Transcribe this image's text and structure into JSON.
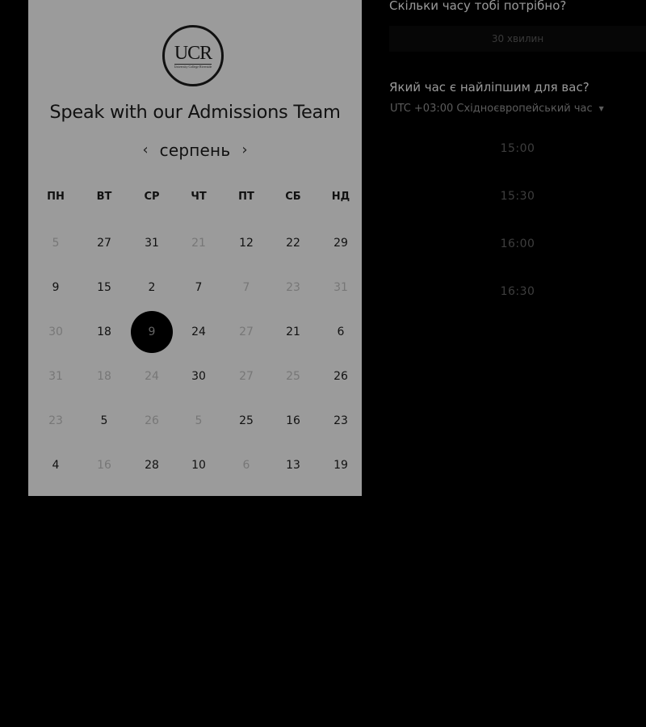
{
  "logo": {
    "text": "UCR",
    "subtext": "University College Riverside"
  },
  "title": "Speak with our Admissions Team",
  "calendar": {
    "month": "серпень",
    "prev_icon": "chevron-left-icon",
    "next_icon": "chevron-right-icon",
    "weekdays": [
      "ПН",
      "ВТ",
      "СР",
      "ЧТ",
      "ПТ",
      "СБ",
      "НД"
    ],
    "weeks": [
      [
        {
          "d": "5",
          "muted": true
        },
        {
          "d": "27",
          "muted": false
        },
        {
          "d": "31",
          "muted": false
        },
        {
          "d": "21",
          "muted": true
        },
        {
          "d": "12",
          "muted": false
        },
        {
          "d": "22",
          "muted": false
        },
        {
          "d": "29",
          "muted": false
        }
      ],
      [
        {
          "d": "9",
          "muted": false
        },
        {
          "d": "15",
          "muted": false
        },
        {
          "d": "2",
          "muted": false
        },
        {
          "d": "7",
          "muted": false
        },
        {
          "d": "7",
          "muted": true
        },
        {
          "d": "23",
          "muted": true
        },
        {
          "d": "31",
          "muted": true
        }
      ],
      [
        {
          "d": "30",
          "muted": true
        },
        {
          "d": "18",
          "muted": false
        },
        {
          "d": "9",
          "muted": false,
          "selected": true
        },
        {
          "d": "24",
          "muted": false
        },
        {
          "d": "27",
          "muted": true
        },
        {
          "d": "21",
          "muted": false
        },
        {
          "d": "6",
          "muted": false
        }
      ],
      [
        {
          "d": "31",
          "muted": true
        },
        {
          "d": "18",
          "muted": true
        },
        {
          "d": "24",
          "muted": true
        },
        {
          "d": "30",
          "muted": false
        },
        {
          "d": "27",
          "muted": true
        },
        {
          "d": "25",
          "muted": true
        },
        {
          "d": "26",
          "muted": false
        }
      ],
      [
        {
          "d": "23",
          "muted": true
        },
        {
          "d": "5",
          "muted": false
        },
        {
          "d": "26",
          "muted": true
        },
        {
          "d": "5",
          "muted": true
        },
        {
          "d": "25",
          "muted": false
        },
        {
          "d": "16",
          "muted": false
        },
        {
          "d": "23",
          "muted": false
        }
      ],
      [
        {
          "d": "4",
          "muted": false
        },
        {
          "d": "16",
          "muted": true
        },
        {
          "d": "28",
          "muted": false
        },
        {
          "d": "10",
          "muted": false
        },
        {
          "d": "6",
          "muted": true
        },
        {
          "d": "13",
          "muted": false
        },
        {
          "d": "19",
          "muted": false
        }
      ]
    ]
  },
  "duration": {
    "question": "Скільки часу тобі потрібно?",
    "value": "30 хвилин"
  },
  "time": {
    "question": "Який час є найліпшим для вас?",
    "timezone": "UTC +03:00 Східноєвропейський час",
    "dropdown_icon": "caret-down-icon",
    "slots": [
      "15:00",
      "15:30",
      "16:00",
      "16:30"
    ]
  },
  "colors": {
    "page_bg": "#000000",
    "card_bg": "#9b9b9b",
    "selected_day_bg": "#000000"
  }
}
